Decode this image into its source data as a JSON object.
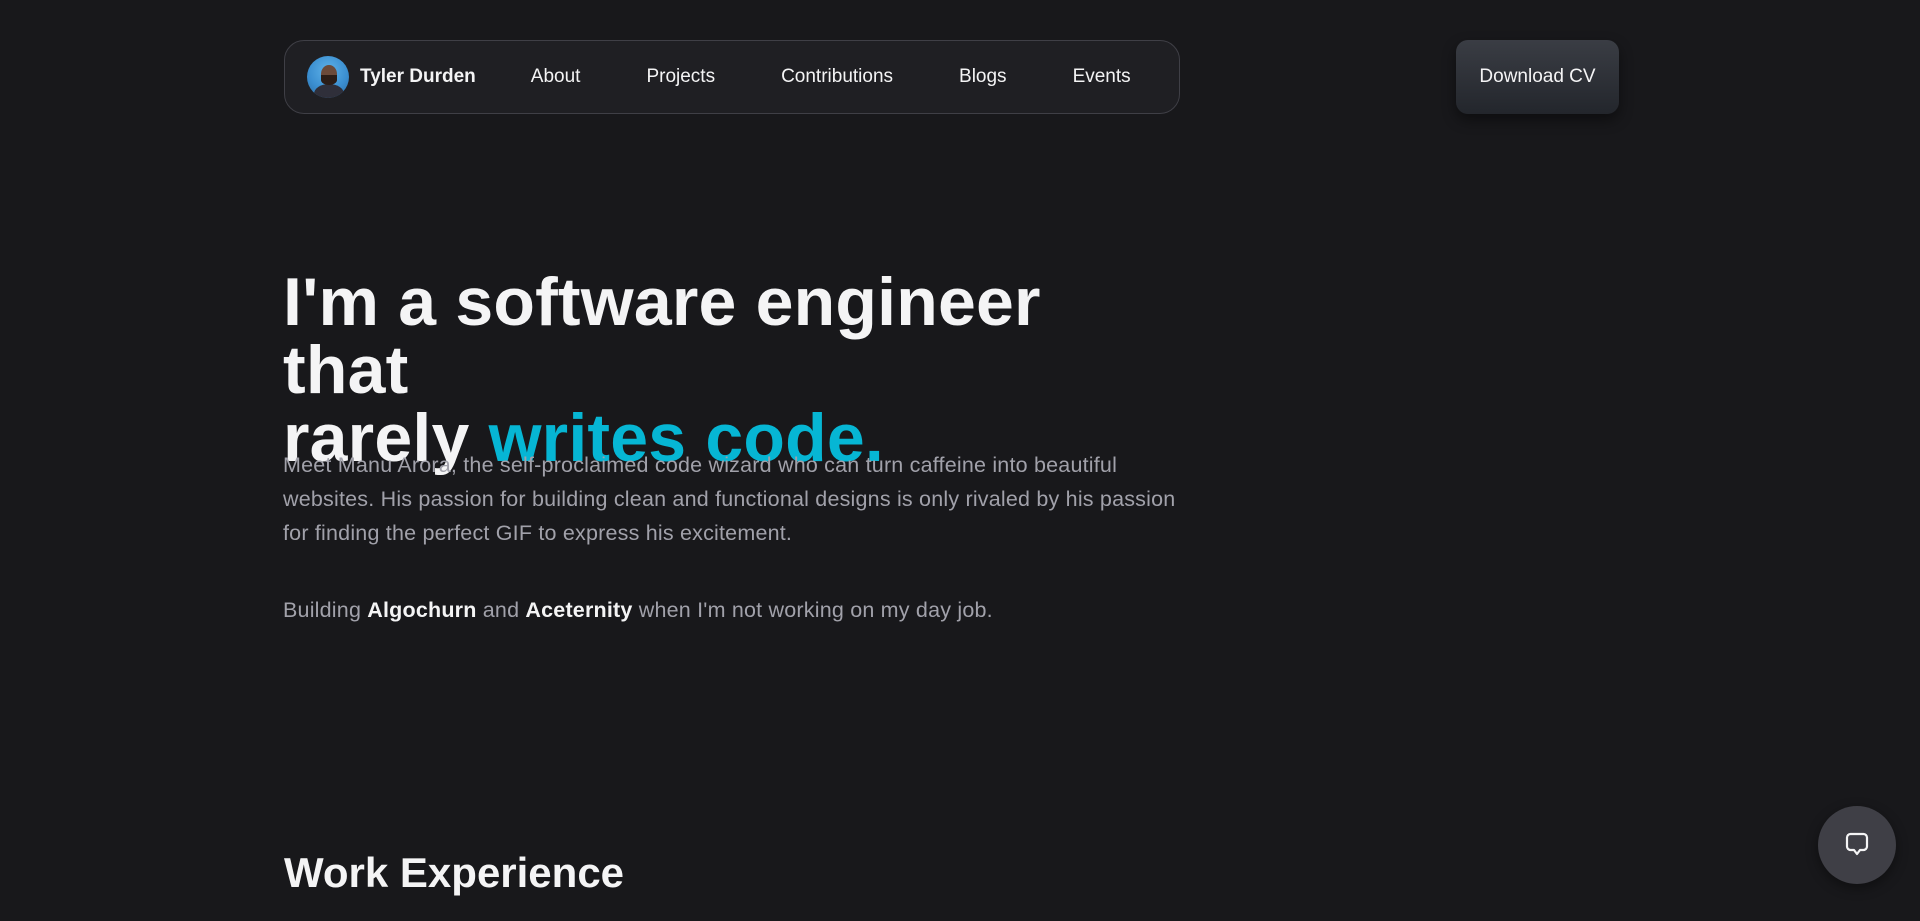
{
  "nav": {
    "brand_name": "Tyler Durden",
    "links": [
      {
        "label": "About"
      },
      {
        "label": "Projects"
      },
      {
        "label": "Contributions"
      },
      {
        "label": "Blogs"
      },
      {
        "label": "Events"
      }
    ]
  },
  "download_cv": {
    "label": "Download CV"
  },
  "hero": {
    "title_line1": "I'm a software engineer that",
    "title_line2_prefix": "rarely ",
    "title_line2_accent": "writes code.",
    "description": "Meet Manu Arora, the self-proclaimed code wizard who can turn caffeine into beautiful websites. His passion for building clean and functional designs is only rivaled by his passion for finding the perfect GIF to express his excitement.",
    "sub_prefix": "Building ",
    "sub_project1": "Algochurn",
    "sub_and": " and ",
    "sub_project2": "Aceternity",
    "sub_suffix": " when I'm not working on my day job."
  },
  "work_experience": {
    "title": "Work Experience"
  },
  "chat": {
    "icon": "chat-bubble-icon"
  },
  "colors": {
    "background": "#18181b",
    "accent": "#06b6d4",
    "text_primary": "#f4f4f5",
    "text_muted": "#a1a1aa"
  }
}
